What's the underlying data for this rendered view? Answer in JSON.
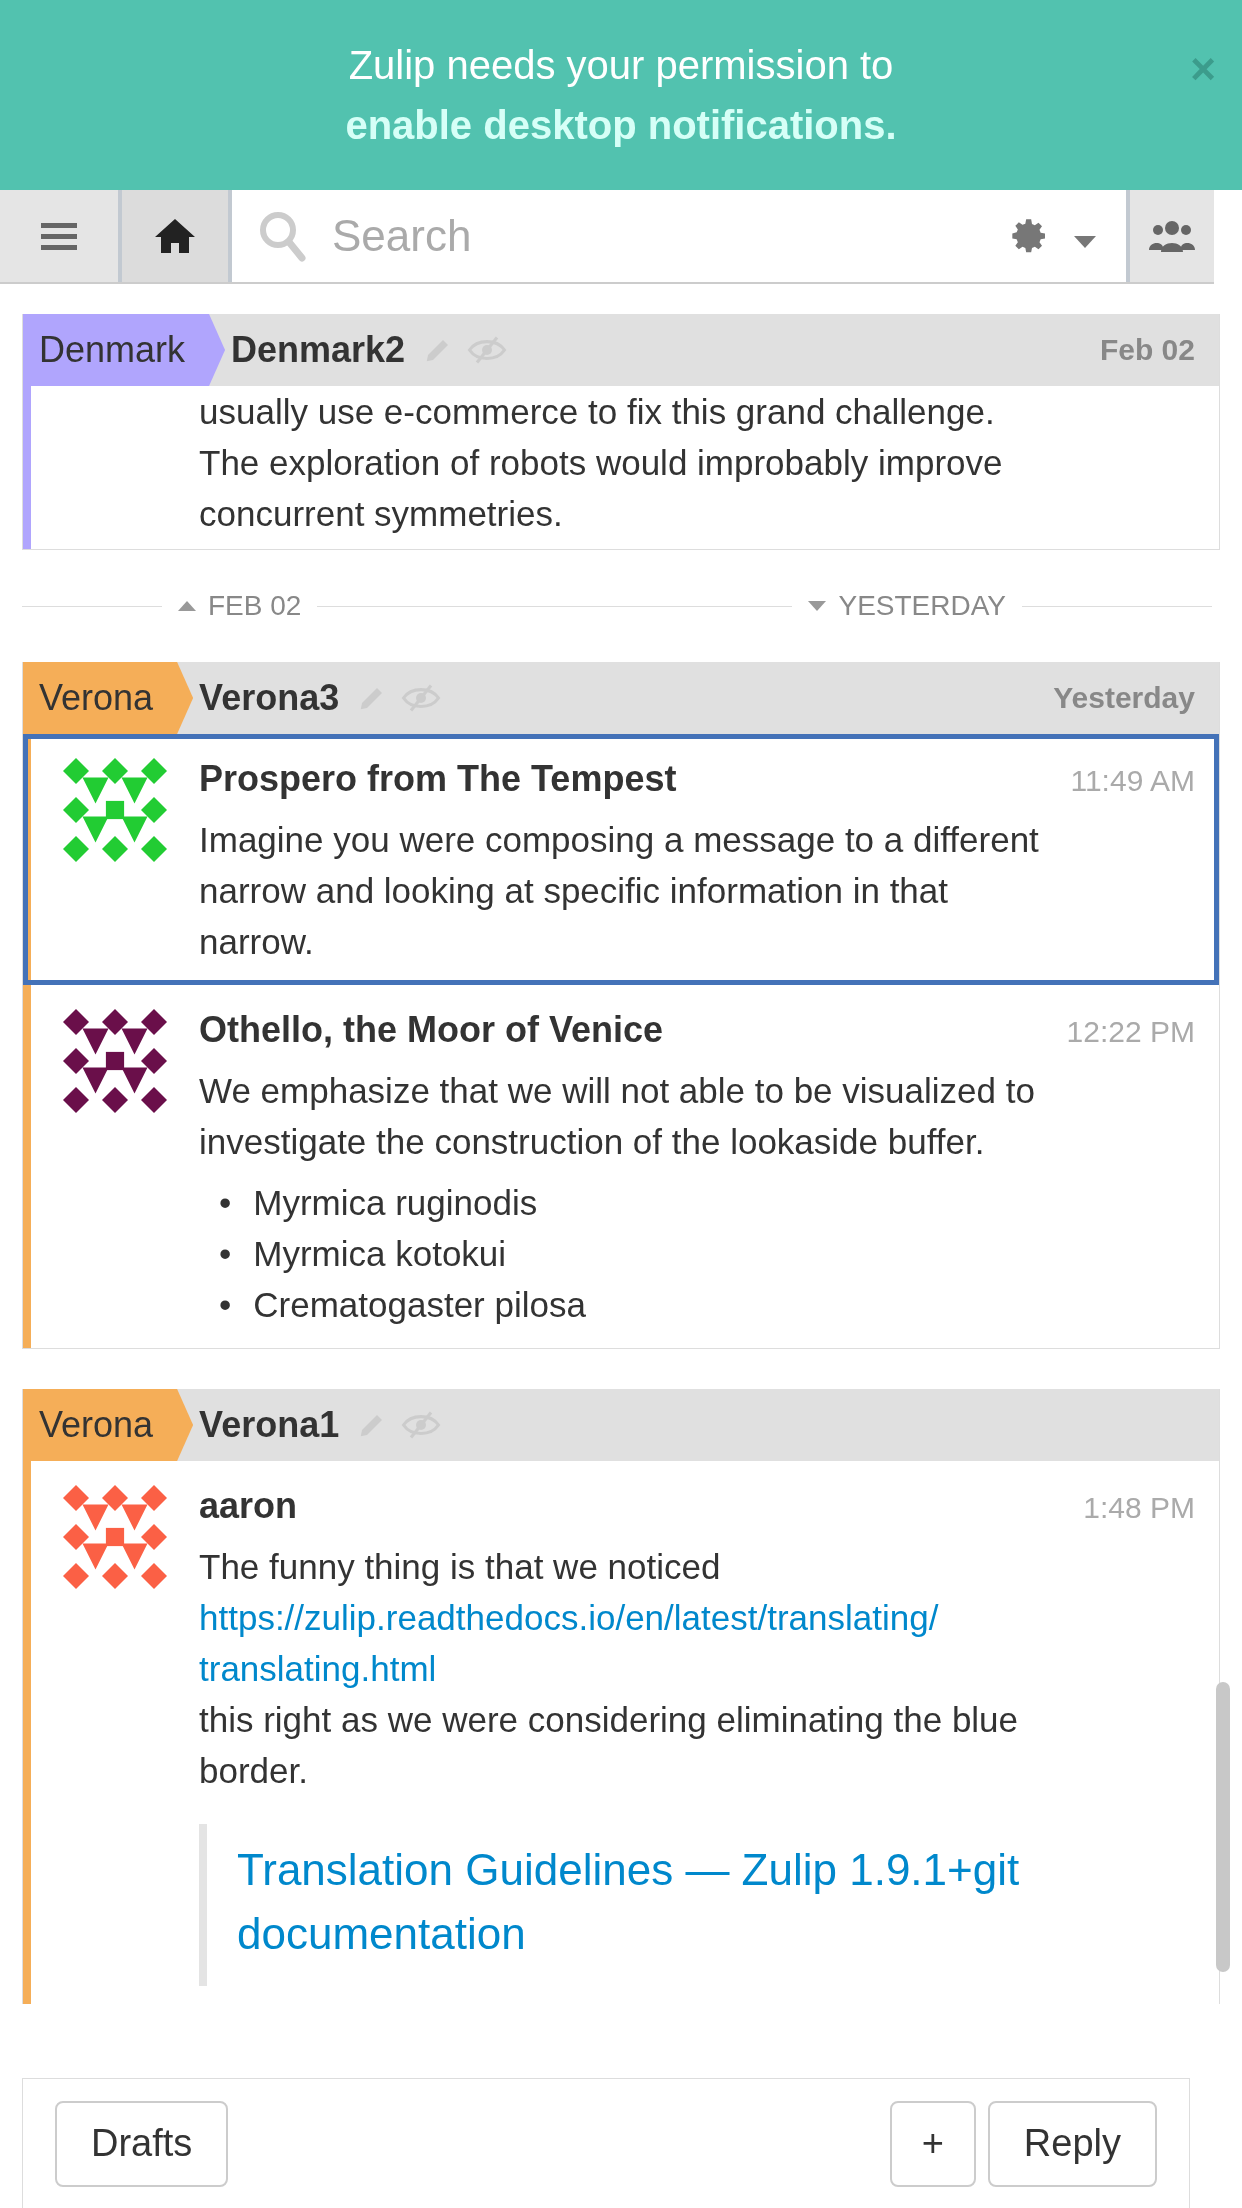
{
  "banner": {
    "text": "Zulip needs your permission to",
    "link": "enable desktop notifications.",
    "close": "×"
  },
  "navbar": {
    "search": {
      "placeholder": "Search"
    }
  },
  "feed": [
    {
      "kind": "recipient",
      "stream": "Denmark",
      "color": "#b0a5fd",
      "topic": "Denmark2",
      "date": "Feb 02",
      "messages": [
        {
          "continued": true,
          "selected": false,
          "content": [
            {
              "kind": "paragraph",
              "parts": [
                {
                  "kind": "text",
                  "text": "usually use e-commerce to fix this grand challenge. The exploration of robots would improbably improve concurrent symmetries."
                }
              ]
            }
          ]
        }
      ]
    },
    {
      "kind": "date_divider",
      "before": "FEB 02",
      "after": "YESTERDAY"
    },
    {
      "kind": "recipient",
      "stream": "Verona",
      "color": "#f5ae58",
      "topic": "Verona3",
      "date": "Yesterday",
      "messages": [
        {
          "continued": false,
          "selected": true,
          "sender": "Prospero from The Tempest",
          "time": "11:49 AM",
          "color": "#22cc33",
          "content": [
            {
              "kind": "paragraph",
              "parts": [
                {
                  "kind": "text",
                  "text": "Imagine you were composing a message to a different narrow and looking at specific information in that narrow."
                }
              ]
            }
          ]
        },
        {
          "continued": false,
          "selected": false,
          "sender": "Othello, the Moor of Venice",
          "time": "12:22 PM",
          "color": "#6a0f4a",
          "content": [
            {
              "kind": "paragraph",
              "parts": [
                {
                  "kind": "text",
                  "text": "We emphasize that we will not able to be visualized to investigate the construction of the lookaside buffer."
                }
              ]
            },
            {
              "kind": "list",
              "bullet": "•",
              "items": [
                "Myrmica ruginodis",
                "Myrmica kotokui",
                "Crematogaster pilosa"
              ]
            }
          ]
        }
      ]
    },
    {
      "kind": "recipient",
      "stream": "Verona",
      "color": "#f5ae58",
      "topic": "Verona1",
      "messages": [
        {
          "continued": false,
          "selected": false,
          "sender": "aaron",
          "time": "1:48 PM",
          "color": "#fb6045",
          "content": [
            {
              "kind": "paragraph",
              "parts": [
                {
                  "kind": "text",
                  "text": "The funny thing is that we noticed "
                },
                {
                  "kind": "link",
                  "text": "https://zulip.readthedocs.io/en/latest/translating/translating.html"
                },
                {
                  "kind": "text",
                  "text": " this right as we were considering eliminating the blue border."
                }
              ]
            },
            {
              "kind": "preview",
              "title": "Translation Guidelines — Zulip 1.9.1+git documentation"
            }
          ]
        }
      ]
    }
  ],
  "compose": {
    "buttons": [
      {
        "kind": "drafts",
        "label": "Drafts"
      },
      {
        "kind": "new",
        "label": "+"
      },
      {
        "kind": "reply",
        "label": "Reply"
      }
    ]
  }
}
